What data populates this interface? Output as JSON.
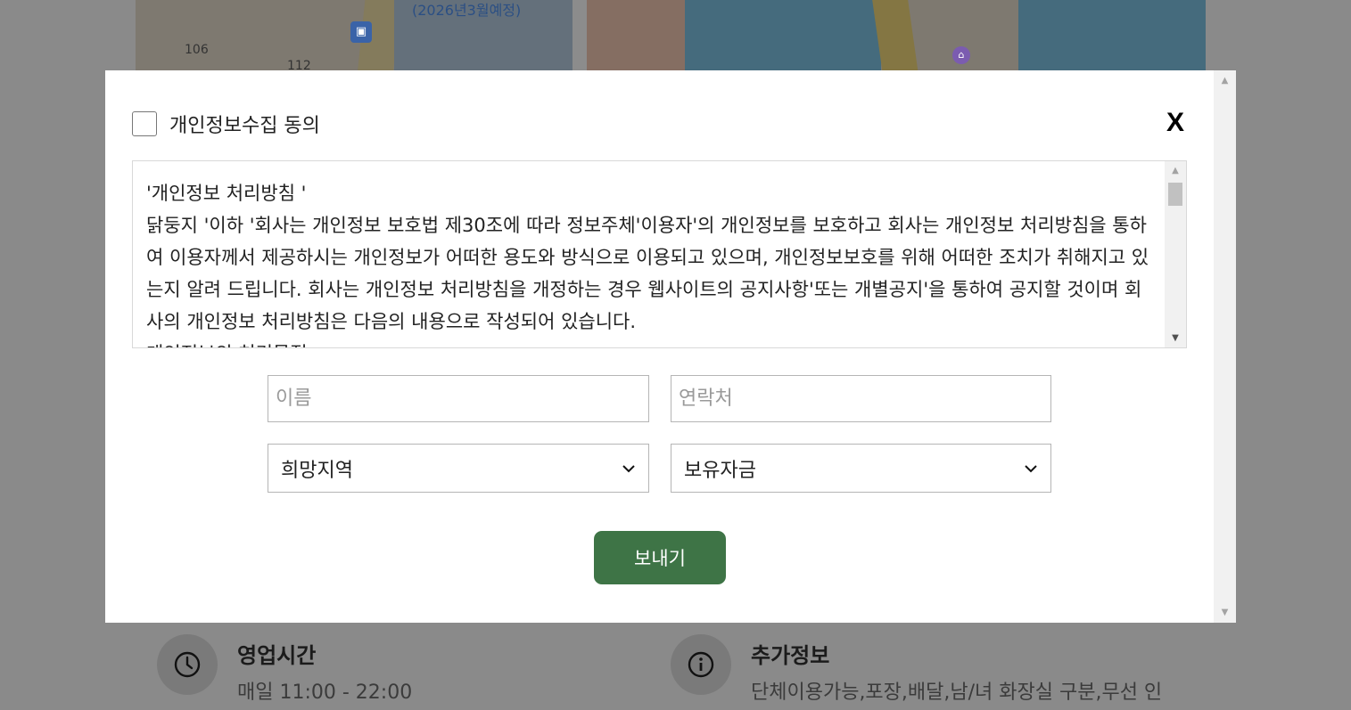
{
  "map": {
    "labels": [
      "(2026년3월예정)",
      "106",
      "112"
    ],
    "bus_icon_glyph": "▣",
    "hotel_icon_glyph": "⌂"
  },
  "info": {
    "hours_title": "영업시간",
    "hours_value": "매일 11:00 - 22:00",
    "extra_title": "추가정보",
    "extra_value": "단체이용가능,포장,배달,남/녀 화장실 구분,무선 인"
  },
  "modal": {
    "consent_label": "개인정보수집 동의",
    "close_label": "X",
    "policy_text": "'개인정보 처리방침 '\n닭둥지 '이하 '회사는 개인정보 보호법 제30조에 따라 정보주체'이용자'의 개인정보를 보호하고 회사는 개인정보 처리방침을 통하여 이용자께서 제공하시는 개인정보가 어떠한 용도와 방식으로 이용되고 있으며, 개인정보보호를 위해 어떠한 조치가 취해지고 있는지 알려 드립니다. 회사는 개인정보 처리방침을 개정하는 경우 웹사이트의 공지사항'또는 개별공지'을 통하여 공지할 것이며 회사의 개인정보 처리방침은 다음의 내용으로 작성되어 있습니다.\n개인정보의 처리목적",
    "name_placeholder": "이름",
    "name_value": "",
    "contact_placeholder": "연락처",
    "contact_value": "",
    "region_selected": "희망지역",
    "funds_selected": "보유자금",
    "send_label": "보내기"
  },
  "colors": {
    "accent": "#3e7446",
    "overlay": "#8a8a8a"
  }
}
